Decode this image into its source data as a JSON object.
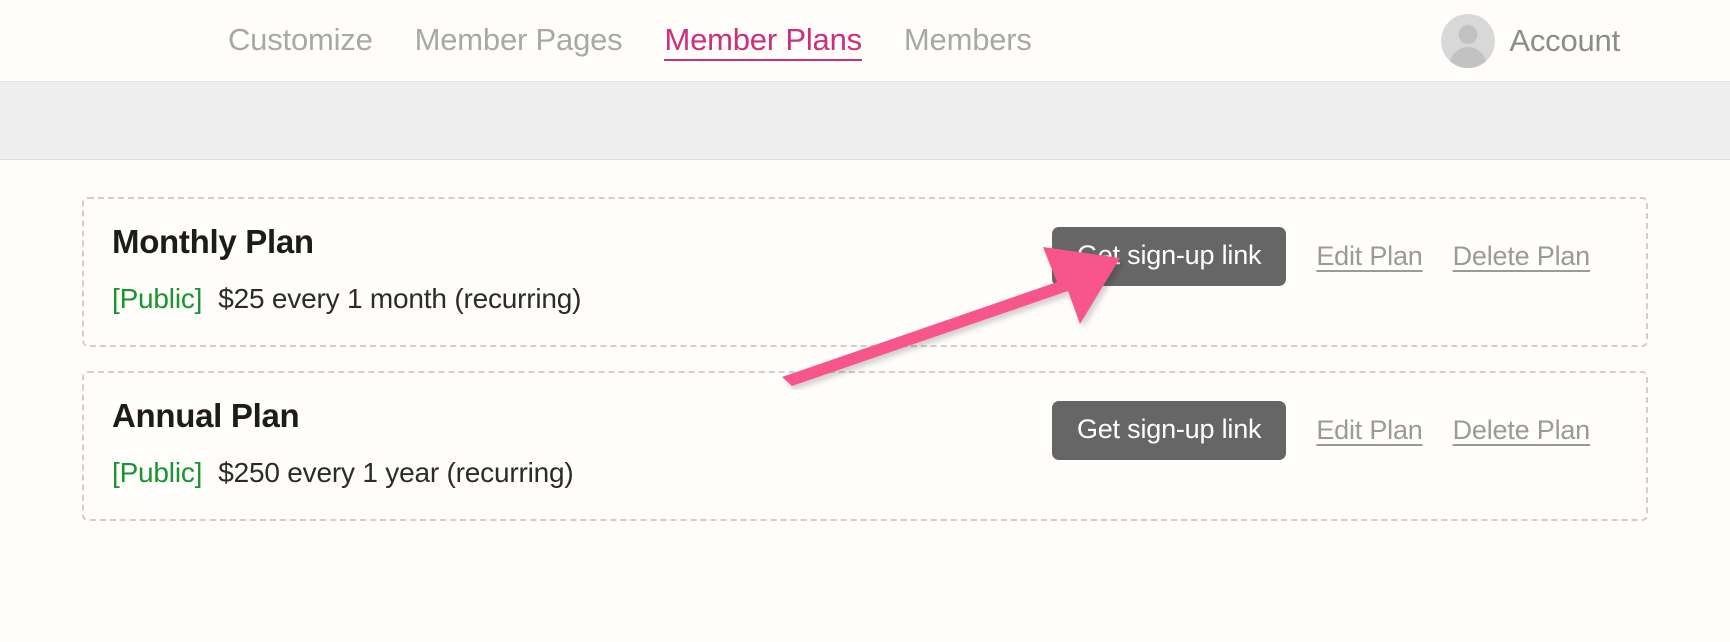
{
  "nav": {
    "tabs": [
      {
        "label": "Customize",
        "active": false
      },
      {
        "label": "Member Pages",
        "active": false
      },
      {
        "label": "Member Plans",
        "active": true
      },
      {
        "label": "Members",
        "active": false
      }
    ],
    "account_label": "Account",
    "avatar_icon": "user-avatar-icon",
    "active_color": "#cc2f7b",
    "inactive_color": "#a8a8a8"
  },
  "subbar": {
    "background": "#eeeeee"
  },
  "plans": [
    {
      "title": "Monthly Plan",
      "visibility": "[Public]",
      "pricing": "$25 every 1 month (recurring)",
      "signup_label": "Get sign-up link",
      "edit_label": "Edit Plan",
      "delete_label": "Delete Plan"
    },
    {
      "title": "Annual Plan",
      "visibility": "[Public]",
      "pricing": "$250 every 1 year (recurring)",
      "signup_label": "Get sign-up link",
      "edit_label": "Edit Plan",
      "delete_label": "Delete Plan"
    }
  ],
  "annotation": {
    "type": "arrow",
    "color": "#f7558c",
    "points_to": "Get sign-up link"
  },
  "colors": {
    "button_background": "#666666",
    "button_text": "#ffffff",
    "visibility_text": "#1a9431",
    "link_text": "#9a9a9a",
    "card_border": "#cfcfcf",
    "page_background": "#fffefb"
  }
}
